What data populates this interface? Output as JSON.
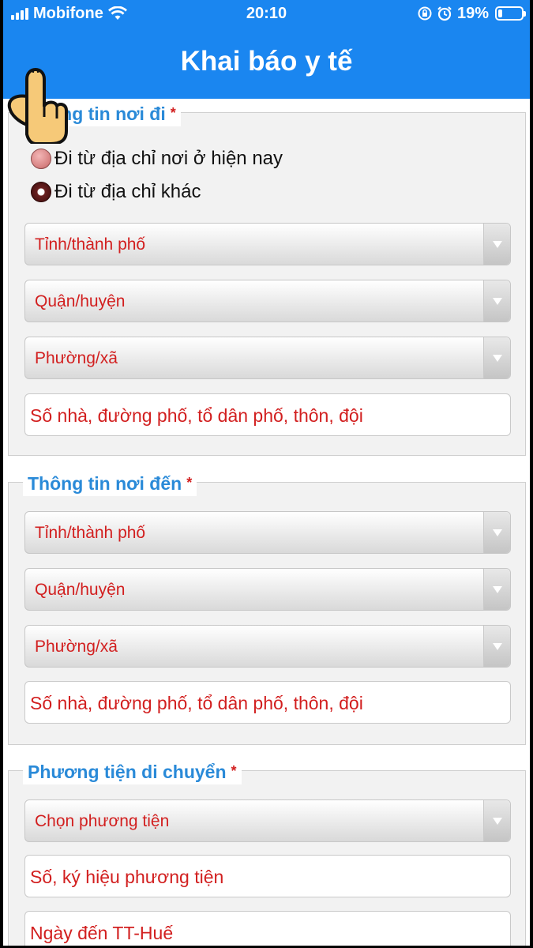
{
  "status_bar": {
    "carrier": "Mobifone",
    "time": "20:10",
    "battery": "19%",
    "battery_level": 0.19
  },
  "header": {
    "title": "Khai báo y tế"
  },
  "sections": {
    "noi_di": {
      "legend": "Thông tin nơi đi",
      "required_mark": "*",
      "radio_current": "Đi từ địa chỉ nơi ở hiện nay",
      "radio_other": "Đi từ địa chỉ khác",
      "selected_radio": "radio_other",
      "province": "Tỉnh/thành phố",
      "district": "Quận/huyện",
      "ward": "Phường/xã",
      "address_placeholder": "Số nhà, đường phố, tổ dân phố, thôn, đội"
    },
    "noi_den": {
      "legend": "Thông tin nơi đến",
      "required_mark": "*",
      "province": "Tỉnh/thành phố",
      "district": "Quận/huyện",
      "ward": "Phường/xã",
      "address_placeholder": "Số nhà, đường phố, tổ dân phố, thôn, đội"
    },
    "phuong_tien": {
      "legend": "Phương tiện di chuyển",
      "required_mark": "*",
      "vehicle_select": "Chọn phương tiện",
      "vehicle_number_placeholder": "Số, ký hiệu phương tiện",
      "arrival_date_placeholder": "Ngày đến TT-Huế"
    }
  },
  "colors": {
    "header_bg": "#1a86f0",
    "legend_text": "#2a8ad8",
    "required": "#d21f1f",
    "placeholder": "#d21f1f"
  }
}
